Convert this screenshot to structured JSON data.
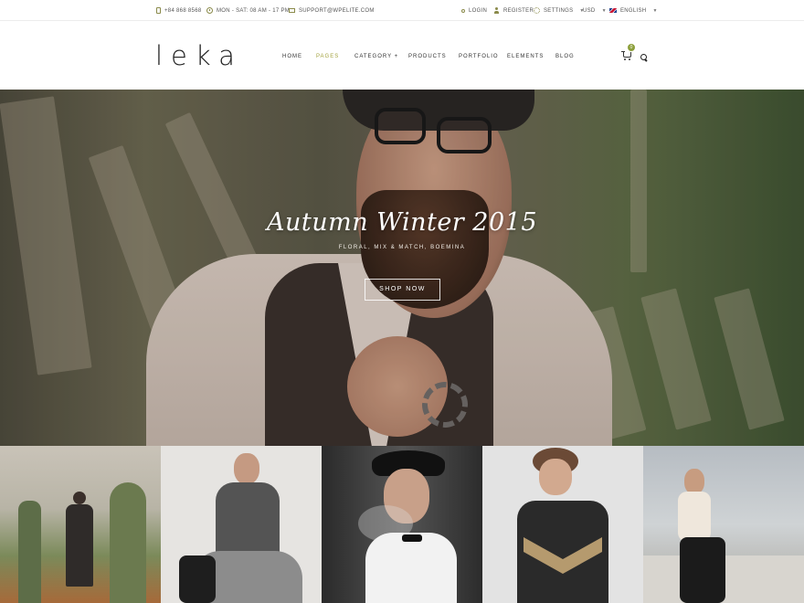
{
  "topbar": {
    "phone": "+84 868 8568",
    "hours": "MON - SAT: 08 AM - 17 PM",
    "email": "SUPPORT@WPELITE.COM",
    "login": "LOGIN",
    "register": "REGISTER",
    "settings": "SETTINGS",
    "currency": "USD",
    "language": "ENGLISH"
  },
  "header": {
    "logo": "leka",
    "nav": [
      {
        "label": "HOME"
      },
      {
        "label": "PAGES"
      },
      {
        "label": "CATEGORY +"
      },
      {
        "label": "PRODUCTS"
      },
      {
        "label": "PORTFOLIO"
      },
      {
        "label": "ELEMENTS"
      },
      {
        "label": "BLOG"
      }
    ],
    "active_nav": "PAGES",
    "cart_count": "0"
  },
  "hero": {
    "title": "Autumn Winter 2015",
    "subtitle": "FLORAL, MIX & MATCH, BOEMINA",
    "button": "SHOP NOW"
  },
  "colors": {
    "accent": "#a3a23f",
    "badge": "#8c9f3a",
    "text": "#333333"
  },
  "icons": [
    "phone-icon",
    "clock-icon",
    "mail-icon",
    "key-icon",
    "user-icon",
    "gear-icon",
    "flag-icon",
    "cart-icon",
    "search-icon"
  ]
}
